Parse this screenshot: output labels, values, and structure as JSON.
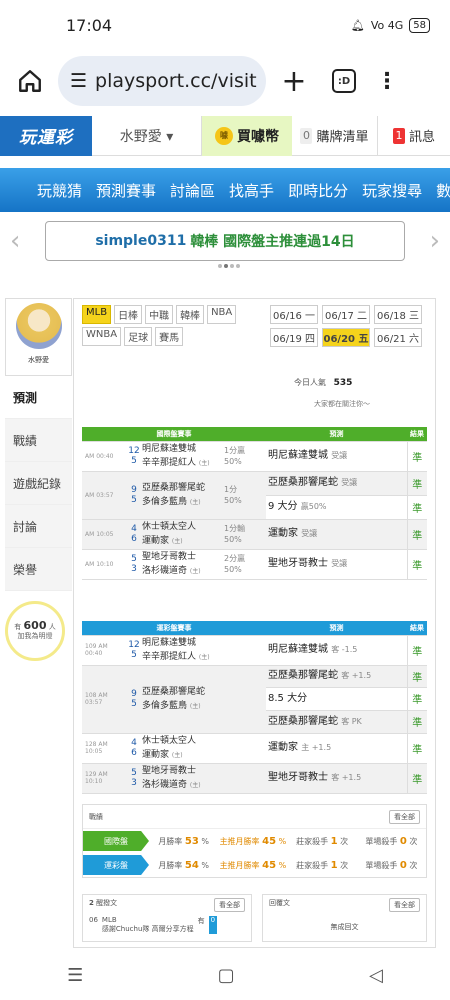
{
  "status": {
    "time": "17:04",
    "net": "Vo 4G",
    "battery": "58"
  },
  "browser": {
    "url": "playsport.cc/visit",
    "tab_label": ":D"
  },
  "topnav": {
    "logo": "玩運彩",
    "user": "水野愛 ▾",
    "coins": "買噱幣",
    "coin_icon": "噱",
    "cart_count": "0",
    "cart": "購牌清單",
    "msg_count": "1",
    "msg": "訊息"
  },
  "mainnav": [
    "玩競猜",
    "預測賽事",
    "討論區",
    "找高手",
    "即時比分",
    "玩家搜尋",
    "數據"
  ],
  "banner": {
    "user": "simple0311",
    "text": "韓棒 國際盤主推連過14日"
  },
  "sidebar": {
    "name": "水野愛",
    "items": [
      "預測",
      "戰績",
      "遊戲紀錄",
      "討論",
      "榮譽"
    ],
    "fans_prefix": "有",
    "fans": "600",
    "fans_suffix": "人",
    "fans_sub": "加我為明燈"
  },
  "leagues": [
    "MLB",
    "日棒",
    "中職",
    "韓棒",
    "NBA",
    "WNBA",
    "足球",
    "賽馬"
  ],
  "dates": [
    "06/16 一",
    "06/17 二",
    "06/18 三",
    "06/19 四",
    "06/20 五",
    "06/21 六"
  ],
  "popularity": {
    "label": "今日人氣",
    "value": "535",
    "watch": "大家都在關注你～"
  },
  "intl": {
    "h1": "國際盤賽事",
    "h2": "預測",
    "h3": "結果",
    "rows": [
      {
        "time": "AM 00:40",
        "s1": "12",
        "s2": "5",
        "t1": "明尼蘇達雙城",
        "t2": "辛辛那提紅人",
        "t2r": "(主)",
        "l1": "1分贏",
        "l2": "50%",
        "picks": [
          {
            "p": "明尼蘇達雙城",
            "n": "受讓",
            "r": "準"
          }
        ]
      },
      {
        "time": "AM 03:57",
        "s1": "9",
        "s2": "5",
        "t1": "亞歷桑那響尾蛇",
        "t2": "多倫多藍鳥",
        "t2r": "(主)",
        "l1": "1分",
        "l2": "50%",
        "picks": [
          {
            "p": "亞歷桑那響尾蛇",
            "n": "受讓",
            "r": "準"
          },
          {
            "p": "9 大分",
            "n": "贏50%",
            "r": "準"
          }
        ]
      },
      {
        "time": "AM 10:05",
        "s1": "4",
        "s2": "6",
        "t1": "休士頓太空人",
        "t2": "運動家",
        "t2r": "(主)",
        "l1": "1分輸",
        "l2": "50%",
        "picks": [
          {
            "p": "運動家",
            "n": "受讓",
            "r": "準"
          }
        ]
      },
      {
        "time": "AM 10:10",
        "s1": "5",
        "s2": "3",
        "t1": "聖地牙哥教士",
        "t2": "洛杉磯道奇",
        "t2r": "(主)",
        "l1": "2分贏",
        "l2": "50%",
        "picks": [
          {
            "p": "聖地牙哥教士",
            "n": "受讓",
            "r": "準"
          }
        ]
      }
    ]
  },
  "lottery": {
    "h1": "運彩盤賽事",
    "h2": "預測",
    "h3": "結果",
    "rows": [
      {
        "time": "109 AM 00:40",
        "s1": "12",
        "s2": "5",
        "t1": "明尼蘇達雙城",
        "t2": "辛辛那提紅人",
        "t2r": "(主)",
        "picks": [
          {
            "p": "明尼蘇達雙城",
            "n": "客 -1.5",
            "r": "準"
          }
        ]
      },
      {
        "time": "108 AM 03:57",
        "s1": "9",
        "s2": "5",
        "t1": "亞歷桑那響尾蛇",
        "t2": "多倫多藍鳥",
        "t2r": "(主)",
        "picks": [
          {
            "p": "亞歷桑那響尾蛇",
            "n": "客 +1.5",
            "r": "準"
          },
          {
            "p": "8.5 大分",
            "n": "",
            "r": "準"
          },
          {
            "p": "亞歷桑那響尾蛇",
            "n": "客 PK",
            "r": "準"
          }
        ]
      },
      {
        "time": "128 AM 10:05",
        "s1": "4",
        "s2": "6",
        "t1": "休士頓太空人",
        "t2": "運動家",
        "t2r": "(主)",
        "picks": [
          {
            "p": "運動家",
            "n": "主 +1.5",
            "r": "準"
          }
        ]
      },
      {
        "time": "129 AM 10:10",
        "s1": "5",
        "s2": "3",
        "t1": "聖地牙哥教士",
        "t2": "洛杉磯道奇",
        "t2r": "(主)",
        "picks": [
          {
            "p": "聖地牙哥教士",
            "n": "客 +1.5",
            "r": "準"
          }
        ]
      }
    ]
  },
  "record": {
    "title": "戰績",
    "more": "看全部",
    "rows": [
      {
        "label": "國際盤",
        "month": "月勝率",
        "m_val": "53",
        "main": "主推月勝率",
        "main_val": "45",
        "kill": "莊家殺手",
        "kill_val": "1",
        "single": "單場殺手",
        "single_val": "0"
      },
      {
        "label": "運彩盤",
        "month": "月勝率",
        "m_val": "54",
        "main": "主推月勝率",
        "main_val": "45",
        "kill": "莊家殺手",
        "kill_val": "1",
        "single": "單場殺手",
        "single_val": "0"
      }
    ]
  },
  "posts": {
    "count": "2",
    "title": "醒撥文",
    "more": "看全部",
    "date": "06",
    "league": "MLB",
    "text": "感謝Chuchu隊 高爾分享方程",
    "tag": "有",
    "tag_count": "0"
  },
  "replies": {
    "title": "回覆文",
    "more": "看全部",
    "empty": "無成回文"
  },
  "colors": {
    "green": "#4fae2a",
    "blue": "#1f9bd8",
    "accent": "#f5d31b",
    "nav": "#1574c6"
  }
}
